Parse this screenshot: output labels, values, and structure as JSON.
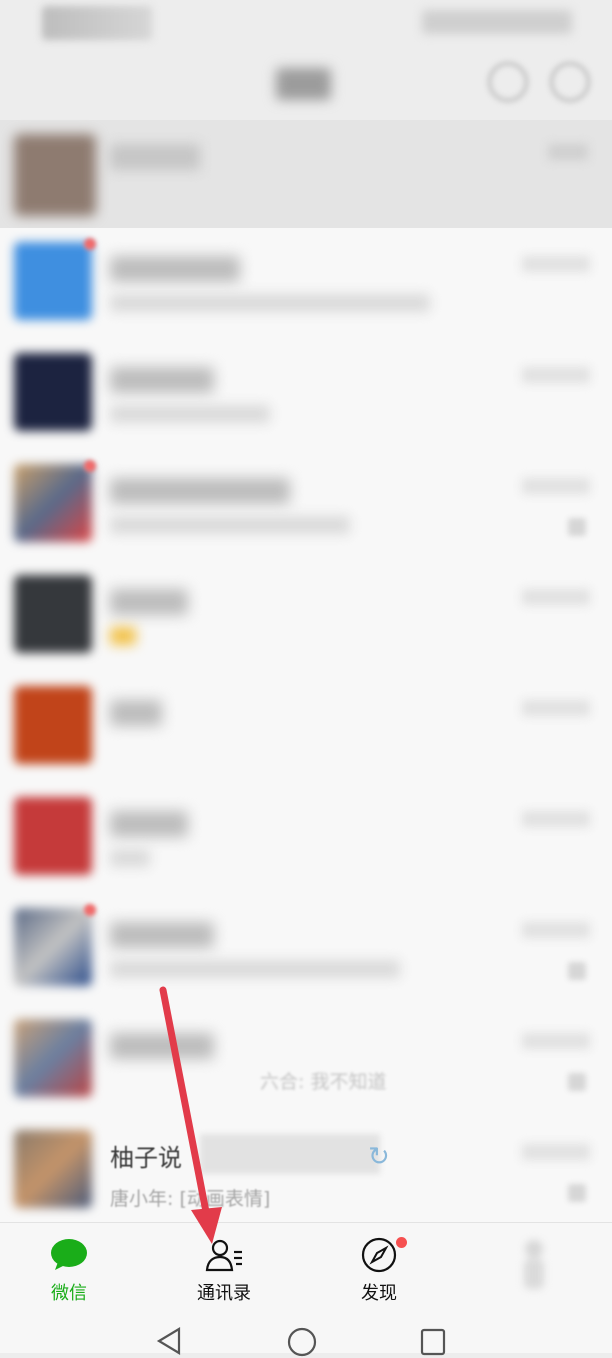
{
  "tabbar": {
    "chats_label": "微信",
    "contacts_label": "通讯录",
    "discover_label": "发现",
    "accent_color": "#1aad19"
  },
  "visible_row": {
    "name_prefix": "柚子说",
    "preview": "唐小年: [动画表情]"
  },
  "partial_preview_text": "六合: 我不知道",
  "icons": {
    "search": "search-icon",
    "add": "plus-circle-icon",
    "chats": "chat-bubble-icon",
    "contacts": "contacts-icon",
    "discover": "compass-icon",
    "me": "person-icon",
    "back": "back-triangle-icon",
    "home": "home-circle-icon",
    "recents": "recents-square-icon"
  },
  "annotation_arrow_color": "#e23b4a"
}
